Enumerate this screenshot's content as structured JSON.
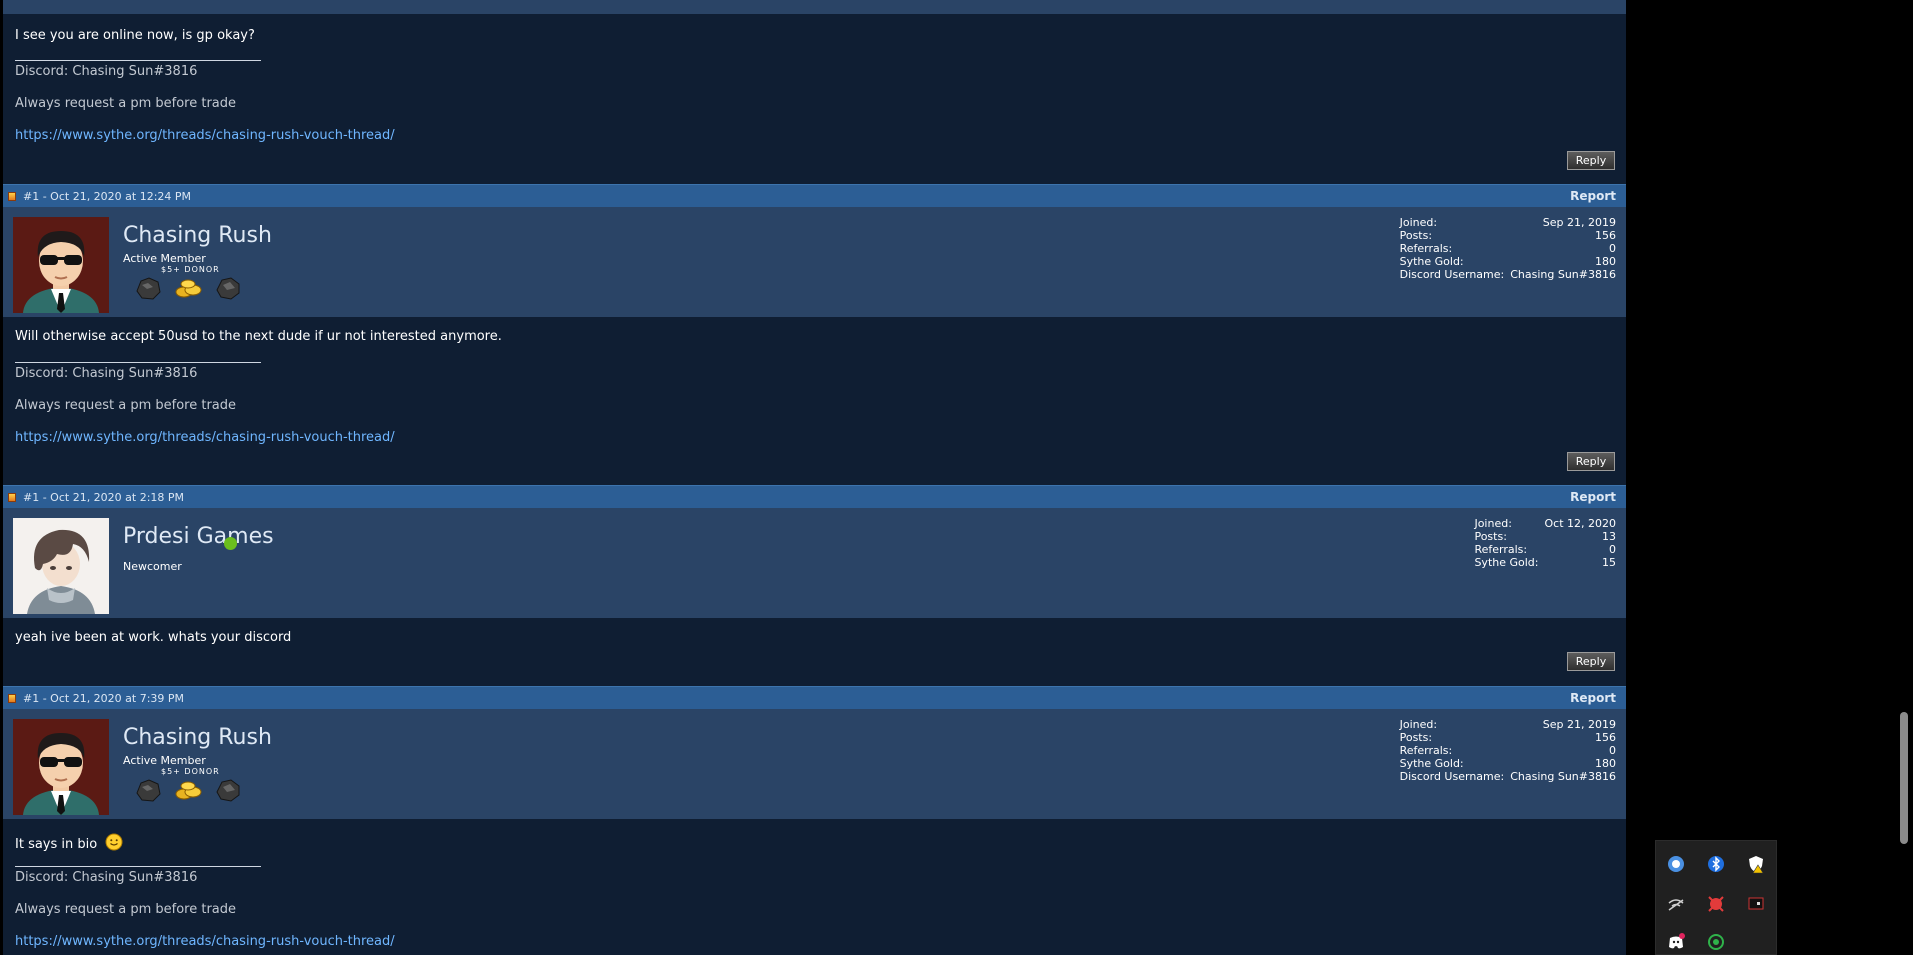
{
  "colors": {
    "page_bg": "#0f1e33",
    "header_bg": "#2c5e95",
    "userbar_bg": "#2a4466",
    "link": "#6fb6ff",
    "online": "#6bbf1d"
  },
  "top_post": {
    "message": "I see you are online now, is gp okay?",
    "signature": {
      "discord": "Discord: Chasing Sun#3816",
      "note": "Always request a pm before trade",
      "link": "https://www.sythe.org/threads/chasing-rush-vouch-thread/"
    },
    "reply_label": "Reply"
  },
  "posts": [
    {
      "meta": "#1 - Oct 21, 2020 at 12:24 PM",
      "report_label": "Report",
      "username": "Chasing Rush",
      "rank": "Active Member",
      "donor_label": "$5+ DONOR",
      "badges": [
        "rock-badge-icon",
        "gold-coins-badge-icon",
        "rock-badge-icon"
      ],
      "stats": [
        {
          "label": "Joined:",
          "value": "Sep 21, 2019"
        },
        {
          "label": "Posts:",
          "value": "156"
        },
        {
          "label": "Referrals:",
          "value": "0"
        },
        {
          "label": "Sythe Gold:",
          "value": "180"
        },
        {
          "label": "Discord Username:",
          "value": "Chasing Sun#3816"
        }
      ],
      "message": "Will otherwise accept 50usd to the next dude if ur not interested anymore.",
      "signature": {
        "discord": "Discord: Chasing Sun#3816",
        "note": "Always request a pm before trade",
        "link": "https://www.sythe.org/threads/chasing-rush-vouch-thread/"
      },
      "reply_label": "Reply"
    },
    {
      "meta": "#1 - Oct 21, 2020 at 2:18 PM",
      "report_label": "Report",
      "username": "Prdesi Games",
      "online": true,
      "rank": "Newcomer",
      "stats": [
        {
          "label": "Joined:",
          "value": "Oct 12, 2020"
        },
        {
          "label": "Posts:",
          "value": "13"
        },
        {
          "label": "Referrals:",
          "value": "0"
        },
        {
          "label": "Sythe Gold:",
          "value": "15"
        }
      ],
      "message": "yeah ive been at work. whats your discord",
      "reply_label": "Reply"
    },
    {
      "meta": "#1 - Oct 21, 2020 at 7:39 PM",
      "report_label": "Report",
      "username": "Chasing Rush",
      "rank": "Active Member",
      "donor_label": "$5+ DONOR",
      "badges": [
        "rock-badge-icon",
        "gold-coins-badge-icon",
        "rock-badge-icon"
      ],
      "stats": [
        {
          "label": "Joined:",
          "value": "Sep 21, 2019"
        },
        {
          "label": "Posts:",
          "value": "156"
        },
        {
          "label": "Referrals:",
          "value": "0"
        },
        {
          "label": "Sythe Gold:",
          "value": "180"
        },
        {
          "label": "Discord Username:",
          "value": "Chasing Sun#3816"
        }
      ],
      "message": "It says in bio",
      "message_emoji": "smile-emoji-icon",
      "signature": {
        "discord": "Discord: Chasing Sun#3816",
        "note": "Always request a pm before trade",
        "link": "https://www.sythe.org/threads/chasing-rush-vouch-thread/"
      }
    }
  ],
  "tray_icons": [
    "google-update-icon",
    "bluetooth-icon",
    "security-warning-icon",
    "network-disconnected-icon",
    "red-app-icon",
    "display-icon",
    "discord-icon",
    "green-app-icon"
  ]
}
